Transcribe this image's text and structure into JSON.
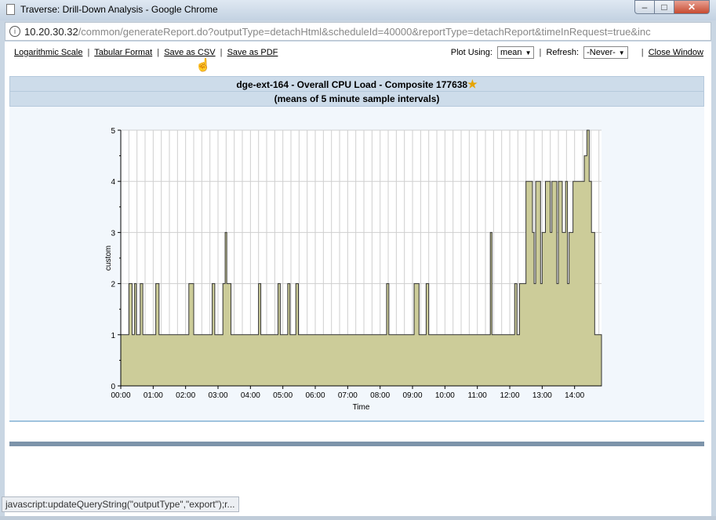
{
  "window": {
    "title": "Traverse: Drill-Down Analysis - Google Chrome",
    "minimize": "–",
    "maximize": "□",
    "close": "✕"
  },
  "address": {
    "host": "10.20.30.32",
    "path": "/common/generateReport.do?outputType=detachHtml&scheduleId=40000&reportType=detachReport&timeInRequest=true&inc"
  },
  "toolbar": {
    "log_scale": "Logarithmic Scale",
    "tabular": "Tabular Format",
    "save_csv": "Save as CSV",
    "save_pdf": "Save as PDF",
    "separator": "|",
    "plot_label": "Plot Using:",
    "plot_value": "mean",
    "refresh_label": "Refresh:",
    "refresh_value": "-Never-",
    "close_window": "Close Window"
  },
  "report": {
    "title": "dge-ext-164 - Overall CPU Load - Composite 177638",
    "subtitle": "(means of 5 minute sample intervals)",
    "star_icon": "star-icon"
  },
  "status_text": "javascript:updateQueryString(\"outputType\",\"export\");r...",
  "chart_data": {
    "type": "area",
    "xlabel": "Time",
    "ylabel": "custom",
    "x_ticks": [
      "00:00",
      "01:00",
      "02:00",
      "03:00",
      "04:00",
      "05:00",
      "06:00",
      "07:00",
      "08:00",
      "09:00",
      "10:00",
      "11:00",
      "12:00",
      "13:00",
      "14:00"
    ],
    "ylim": [
      0,
      5
    ],
    "y_ticks": [
      0,
      1,
      2,
      3,
      4,
      5
    ],
    "xlim_hours": [
      0,
      14.83
    ],
    "grid": true,
    "fill_color": "#cccc99",
    "line_color": "#333333",
    "step_points": [
      [
        0,
        1
      ],
      [
        0.25,
        1
      ],
      [
        0.25,
        2
      ],
      [
        0.35,
        2
      ],
      [
        0.35,
        1
      ],
      [
        0.42,
        1
      ],
      [
        0.42,
        2
      ],
      [
        0.48,
        2
      ],
      [
        0.48,
        1
      ],
      [
        0.6,
        1
      ],
      [
        0.6,
        2
      ],
      [
        0.68,
        2
      ],
      [
        0.68,
        1
      ],
      [
        1.08,
        1
      ],
      [
        1.08,
        2
      ],
      [
        1.18,
        2
      ],
      [
        1.18,
        1
      ],
      [
        2.1,
        1
      ],
      [
        2.1,
        2
      ],
      [
        2.25,
        2
      ],
      [
        2.25,
        1
      ],
      [
        2.82,
        1
      ],
      [
        2.82,
        2
      ],
      [
        2.9,
        2
      ],
      [
        2.9,
        1
      ],
      [
        3.15,
        1
      ],
      [
        3.15,
        2
      ],
      [
        3.22,
        2
      ],
      [
        3.22,
        3
      ],
      [
        3.27,
        3
      ],
      [
        3.27,
        2
      ],
      [
        3.4,
        2
      ],
      [
        3.4,
        1
      ],
      [
        4.25,
        1
      ],
      [
        4.25,
        2
      ],
      [
        4.32,
        2
      ],
      [
        4.32,
        1
      ],
      [
        4.85,
        1
      ],
      [
        4.85,
        2
      ],
      [
        4.92,
        2
      ],
      [
        4.92,
        1
      ],
      [
        5.15,
        1
      ],
      [
        5.15,
        2
      ],
      [
        5.22,
        2
      ],
      [
        5.22,
        1
      ],
      [
        5.4,
        1
      ],
      [
        5.4,
        2
      ],
      [
        5.48,
        2
      ],
      [
        5.48,
        1
      ],
      [
        8.2,
        1
      ],
      [
        8.2,
        2
      ],
      [
        8.27,
        2
      ],
      [
        8.27,
        1
      ],
      [
        9.05,
        1
      ],
      [
        9.05,
        2
      ],
      [
        9.2,
        2
      ],
      [
        9.2,
        1
      ],
      [
        9.42,
        1
      ],
      [
        9.42,
        2
      ],
      [
        9.5,
        2
      ],
      [
        9.5,
        1
      ],
      [
        11.4,
        1
      ],
      [
        11.4,
        3
      ],
      [
        11.45,
        3
      ],
      [
        11.45,
        1
      ],
      [
        12.15,
        1
      ],
      [
        12.15,
        2
      ],
      [
        12.22,
        2
      ],
      [
        12.22,
        1
      ],
      [
        12.3,
        1
      ],
      [
        12.3,
        2
      ],
      [
        12.4,
        2
      ],
      [
        12.5,
        2
      ],
      [
        12.5,
        4
      ],
      [
        12.7,
        4
      ],
      [
        12.7,
        3
      ],
      [
        12.75,
        3
      ],
      [
        12.75,
        2
      ],
      [
        12.8,
        2
      ],
      [
        12.8,
        4
      ],
      [
        12.95,
        4
      ],
      [
        12.95,
        2
      ],
      [
        13.0,
        2
      ],
      [
        13.0,
        3
      ],
      [
        13.1,
        3
      ],
      [
        13.1,
        4
      ],
      [
        13.25,
        4
      ],
      [
        13.25,
        3
      ],
      [
        13.3,
        3
      ],
      [
        13.3,
        4
      ],
      [
        13.45,
        4
      ],
      [
        13.45,
        2
      ],
      [
        13.5,
        2
      ],
      [
        13.5,
        4
      ],
      [
        13.62,
        4
      ],
      [
        13.62,
        3
      ],
      [
        13.72,
        3
      ],
      [
        13.72,
        4
      ],
      [
        13.78,
        4
      ],
      [
        13.78,
        2
      ],
      [
        13.83,
        2
      ],
      [
        13.83,
        3
      ],
      [
        13.95,
        3
      ],
      [
        13.95,
        4
      ],
      [
        14.3,
        4
      ],
      [
        14.3,
        4.5
      ],
      [
        14.38,
        4.5
      ],
      [
        14.38,
        5
      ],
      [
        14.45,
        5
      ],
      [
        14.45,
        4
      ],
      [
        14.52,
        4
      ],
      [
        14.52,
        3
      ],
      [
        14.62,
        3
      ],
      [
        14.62,
        1
      ],
      [
        14.83,
        1
      ]
    ]
  }
}
